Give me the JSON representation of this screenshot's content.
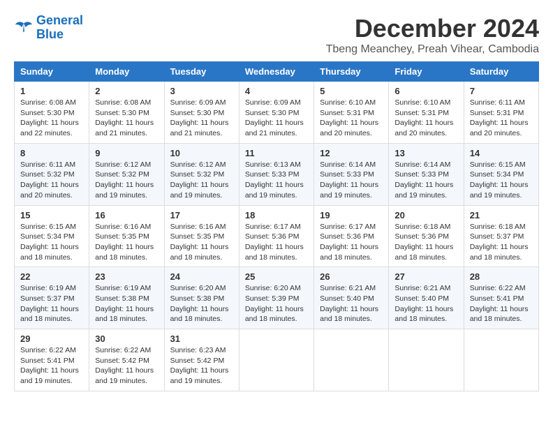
{
  "header": {
    "logo_line1": "General",
    "logo_line2": "Blue",
    "month_title": "December 2024",
    "subtitle": "Tbeng Meanchey, Preah Vihear, Cambodia"
  },
  "weekdays": [
    "Sunday",
    "Monday",
    "Tuesday",
    "Wednesday",
    "Thursday",
    "Friday",
    "Saturday"
  ],
  "weeks": [
    [
      {
        "day": "1",
        "info": "Sunrise: 6:08 AM\nSunset: 5:30 PM\nDaylight: 11 hours\nand 22 minutes."
      },
      {
        "day": "2",
        "info": "Sunrise: 6:08 AM\nSunset: 5:30 PM\nDaylight: 11 hours\nand 21 minutes."
      },
      {
        "day": "3",
        "info": "Sunrise: 6:09 AM\nSunset: 5:30 PM\nDaylight: 11 hours\nand 21 minutes."
      },
      {
        "day": "4",
        "info": "Sunrise: 6:09 AM\nSunset: 5:30 PM\nDaylight: 11 hours\nand 21 minutes."
      },
      {
        "day": "5",
        "info": "Sunrise: 6:10 AM\nSunset: 5:31 PM\nDaylight: 11 hours\nand 20 minutes."
      },
      {
        "day": "6",
        "info": "Sunrise: 6:10 AM\nSunset: 5:31 PM\nDaylight: 11 hours\nand 20 minutes."
      },
      {
        "day": "7",
        "info": "Sunrise: 6:11 AM\nSunset: 5:31 PM\nDaylight: 11 hours\nand 20 minutes."
      }
    ],
    [
      {
        "day": "8",
        "info": "Sunrise: 6:11 AM\nSunset: 5:32 PM\nDaylight: 11 hours\nand 20 minutes."
      },
      {
        "day": "9",
        "info": "Sunrise: 6:12 AM\nSunset: 5:32 PM\nDaylight: 11 hours\nand 19 minutes."
      },
      {
        "day": "10",
        "info": "Sunrise: 6:12 AM\nSunset: 5:32 PM\nDaylight: 11 hours\nand 19 minutes."
      },
      {
        "day": "11",
        "info": "Sunrise: 6:13 AM\nSunset: 5:33 PM\nDaylight: 11 hours\nand 19 minutes."
      },
      {
        "day": "12",
        "info": "Sunrise: 6:14 AM\nSunset: 5:33 PM\nDaylight: 11 hours\nand 19 minutes."
      },
      {
        "day": "13",
        "info": "Sunrise: 6:14 AM\nSunset: 5:33 PM\nDaylight: 11 hours\nand 19 minutes."
      },
      {
        "day": "14",
        "info": "Sunrise: 6:15 AM\nSunset: 5:34 PM\nDaylight: 11 hours\nand 19 minutes."
      }
    ],
    [
      {
        "day": "15",
        "info": "Sunrise: 6:15 AM\nSunset: 5:34 PM\nDaylight: 11 hours\nand 18 minutes."
      },
      {
        "day": "16",
        "info": "Sunrise: 6:16 AM\nSunset: 5:35 PM\nDaylight: 11 hours\nand 18 minutes."
      },
      {
        "day": "17",
        "info": "Sunrise: 6:16 AM\nSunset: 5:35 PM\nDaylight: 11 hours\nand 18 minutes."
      },
      {
        "day": "18",
        "info": "Sunrise: 6:17 AM\nSunset: 5:36 PM\nDaylight: 11 hours\nand 18 minutes."
      },
      {
        "day": "19",
        "info": "Sunrise: 6:17 AM\nSunset: 5:36 PM\nDaylight: 11 hours\nand 18 minutes."
      },
      {
        "day": "20",
        "info": "Sunrise: 6:18 AM\nSunset: 5:36 PM\nDaylight: 11 hours\nand 18 minutes."
      },
      {
        "day": "21",
        "info": "Sunrise: 6:18 AM\nSunset: 5:37 PM\nDaylight: 11 hours\nand 18 minutes."
      }
    ],
    [
      {
        "day": "22",
        "info": "Sunrise: 6:19 AM\nSunset: 5:37 PM\nDaylight: 11 hours\nand 18 minutes."
      },
      {
        "day": "23",
        "info": "Sunrise: 6:19 AM\nSunset: 5:38 PM\nDaylight: 11 hours\nand 18 minutes."
      },
      {
        "day": "24",
        "info": "Sunrise: 6:20 AM\nSunset: 5:38 PM\nDaylight: 11 hours\nand 18 minutes."
      },
      {
        "day": "25",
        "info": "Sunrise: 6:20 AM\nSunset: 5:39 PM\nDaylight: 11 hours\nand 18 minutes."
      },
      {
        "day": "26",
        "info": "Sunrise: 6:21 AM\nSunset: 5:40 PM\nDaylight: 11 hours\nand 18 minutes."
      },
      {
        "day": "27",
        "info": "Sunrise: 6:21 AM\nSunset: 5:40 PM\nDaylight: 11 hours\nand 18 minutes."
      },
      {
        "day": "28",
        "info": "Sunrise: 6:22 AM\nSunset: 5:41 PM\nDaylight: 11 hours\nand 18 minutes."
      }
    ],
    [
      {
        "day": "29",
        "info": "Sunrise: 6:22 AM\nSunset: 5:41 PM\nDaylight: 11 hours\nand 19 minutes."
      },
      {
        "day": "30",
        "info": "Sunrise: 6:22 AM\nSunset: 5:42 PM\nDaylight: 11 hours\nand 19 minutes."
      },
      {
        "day": "31",
        "info": "Sunrise: 6:23 AM\nSunset: 5:42 PM\nDaylight: 11 hours\nand 19 minutes."
      },
      null,
      null,
      null,
      null
    ]
  ]
}
